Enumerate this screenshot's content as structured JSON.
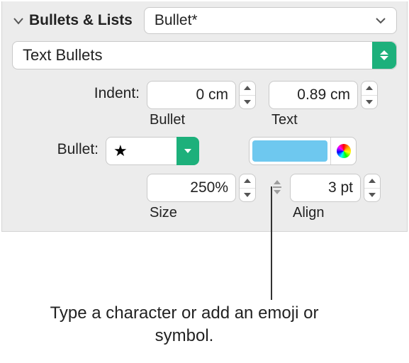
{
  "section_title": "Bullets & Lists",
  "style_dropdown": {
    "value": "Bullet*"
  },
  "type_dropdown": {
    "value": "Text Bullets"
  },
  "indent": {
    "label": "Indent:",
    "bullet": {
      "value": "0 cm",
      "label": "Bullet"
    },
    "text": {
      "value": "0.89 cm",
      "label": "Text"
    }
  },
  "bullet": {
    "label": "Bullet:",
    "glyph": "★",
    "color": "#6ec8ef"
  },
  "size": {
    "value": "250%",
    "label": "Size"
  },
  "align": {
    "value": "3 pt",
    "label": "Align"
  },
  "callout": "Type a character or add an emoji or symbol."
}
